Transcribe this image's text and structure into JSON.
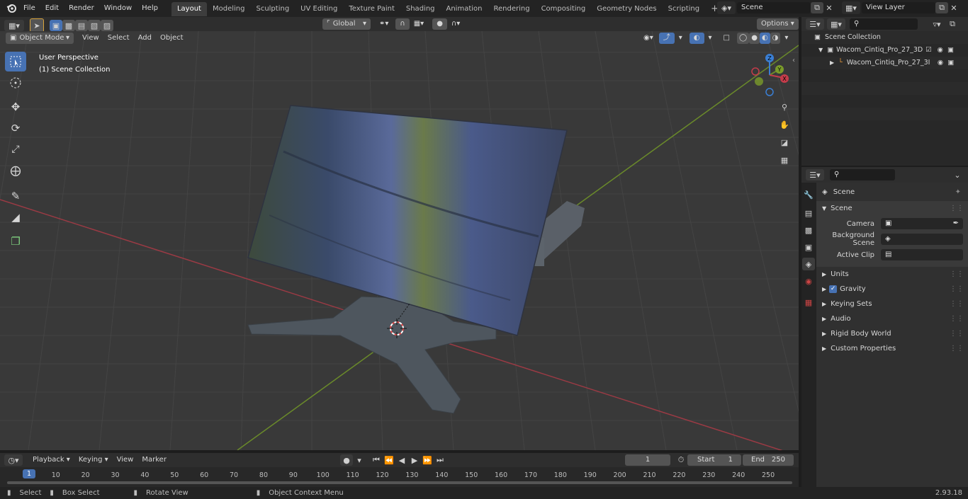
{
  "topbar": {
    "menus": [
      "File",
      "Edit",
      "Render",
      "Window",
      "Help"
    ],
    "workspaces": [
      "Layout",
      "Modeling",
      "Sculpting",
      "UV Editing",
      "Texture Paint",
      "Shading",
      "Animation",
      "Rendering",
      "Compositing",
      "Geometry Nodes",
      "Scripting"
    ],
    "active_workspace": "Layout",
    "add_tab": "+",
    "scene_name": "Scene",
    "view_layer": "View Layer"
  },
  "viewport_header": {
    "mode": "Object Mode",
    "menus": [
      "View",
      "Select",
      "Add",
      "Object"
    ],
    "orientation": "Global",
    "options": "Options"
  },
  "viewport": {
    "overlay_title": "User Perspective",
    "overlay_subtitle": "(1) Scene Collection",
    "gizmo": {
      "x": "X",
      "y": "Y",
      "z": "Z"
    }
  },
  "outliner": {
    "root": "Scene Collection",
    "items": [
      {
        "label": "Wacom_Cintiq_Pro_27_3D_Pr"
      },
      {
        "label": "Wacom_Cintiq_Pro_27_3I"
      }
    ]
  },
  "properties": {
    "context": "Scene",
    "section": "Scene",
    "fields": [
      {
        "label": "Camera"
      },
      {
        "label": "Background Scene"
      },
      {
        "label": "Active Clip"
      }
    ],
    "panels": [
      "Units",
      "Gravity",
      "Keying Sets",
      "Audio",
      "Rigid Body World",
      "Custom Properties"
    ],
    "gravity_checked": true
  },
  "timeline": {
    "menus": [
      "Playback",
      "Keying",
      "View",
      "Marker"
    ],
    "current_frame": "1",
    "start_label": "Start",
    "start": "1",
    "end_label": "End",
    "end": "250",
    "ticks": [
      "1",
      "10",
      "20",
      "30",
      "40",
      "50",
      "60",
      "70",
      "80",
      "90",
      "100",
      "110",
      "120",
      "130",
      "140",
      "150",
      "160",
      "170",
      "180",
      "190",
      "200",
      "210",
      "220",
      "230",
      "240",
      "250"
    ]
  },
  "statusbar": {
    "select": "Select",
    "box_select": "Box Select",
    "rotate": "Rotate View",
    "context_menu": "Object Context Menu",
    "version": "2.93.18"
  },
  "colors": {
    "accent": "#4772b3",
    "x_axis": "#c43c4a",
    "y_axis": "#7a9b2a",
    "z_axis": "#3a7fd5"
  }
}
